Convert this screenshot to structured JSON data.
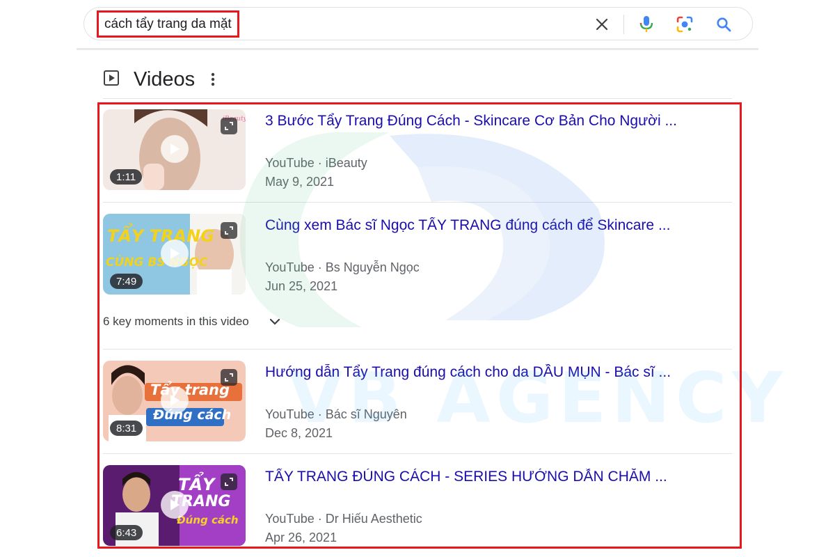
{
  "search": {
    "query": "cách tẩy trang da mặt",
    "clear_icon": "close-icon",
    "voice_icon": "microphone-icon",
    "lens_icon": "camera-lens-icon",
    "search_icon": "search-icon"
  },
  "section": {
    "title": "Videos",
    "icon": "play-box-icon",
    "more_icon": "more-vertical-icon"
  },
  "videos": [
    {
      "title": "3 Bước Tẩy Trang Đúng Cách - Skincare Cơ Bản Cho Người ...",
      "source": "YouTube · iBeauty",
      "date": "May 9, 2021",
      "duration": "1:11",
      "thumb_text": [],
      "thumb_colors": [
        "#f3e9e4",
        "#d9b9a6",
        "#5b3b2e"
      ]
    },
    {
      "title": "Cùng xem Bác sĩ Ngọc TẨY TRANG đúng cách để Skincare ...",
      "source": "YouTube · Bs Nguyễn Ngọc",
      "date": "Jun 25, 2021",
      "duration": "7:49",
      "thumb_text": [
        "TẨY TRANG",
        "CÙNG BS NGỌC"
      ],
      "thumb_colors": [
        "#8fc6e2",
        "#f2d21b",
        "#f6f4f0"
      ]
    },
    {
      "title": "Hướng dẫn Tẩy Trang đúng cách cho da DẦU MỤN - Bác sĩ ...",
      "source": "YouTube · Bác sĩ Nguyên",
      "date": "Dec 8, 2021",
      "duration": "8:31",
      "thumb_text": [
        "Tẩy trang",
        "Đúng cách"
      ],
      "thumb_colors": [
        "#f5c9b7",
        "#e8703a",
        "#2f6fc4"
      ]
    },
    {
      "title": "TẨY TRANG ĐÚNG CÁCH - SERIES HƯỚNG DẪN CHĂM ...",
      "source": "YouTube · Dr Hiếu Aesthetic",
      "date": "Apr 26, 2021",
      "duration": "6:43",
      "thumb_text": [
        "TẨY",
        "TRANG",
        "Đúng cách"
      ],
      "thumb_colors": [
        "#5a1c6e",
        "#a23fc4",
        "#f5d12a"
      ]
    }
  ],
  "key_moments": {
    "label": "6 key moments in this video",
    "icon": "chevron-down-icon"
  },
  "watermark": {
    "text": "VB AGENCY",
    "colors": [
      "#4fc38a",
      "#3a7ee0",
      "#38b6ff"
    ]
  },
  "colors": {
    "link": "#1a0dab",
    "highlight": "#e8161d",
    "meta": "#5f6368"
  }
}
